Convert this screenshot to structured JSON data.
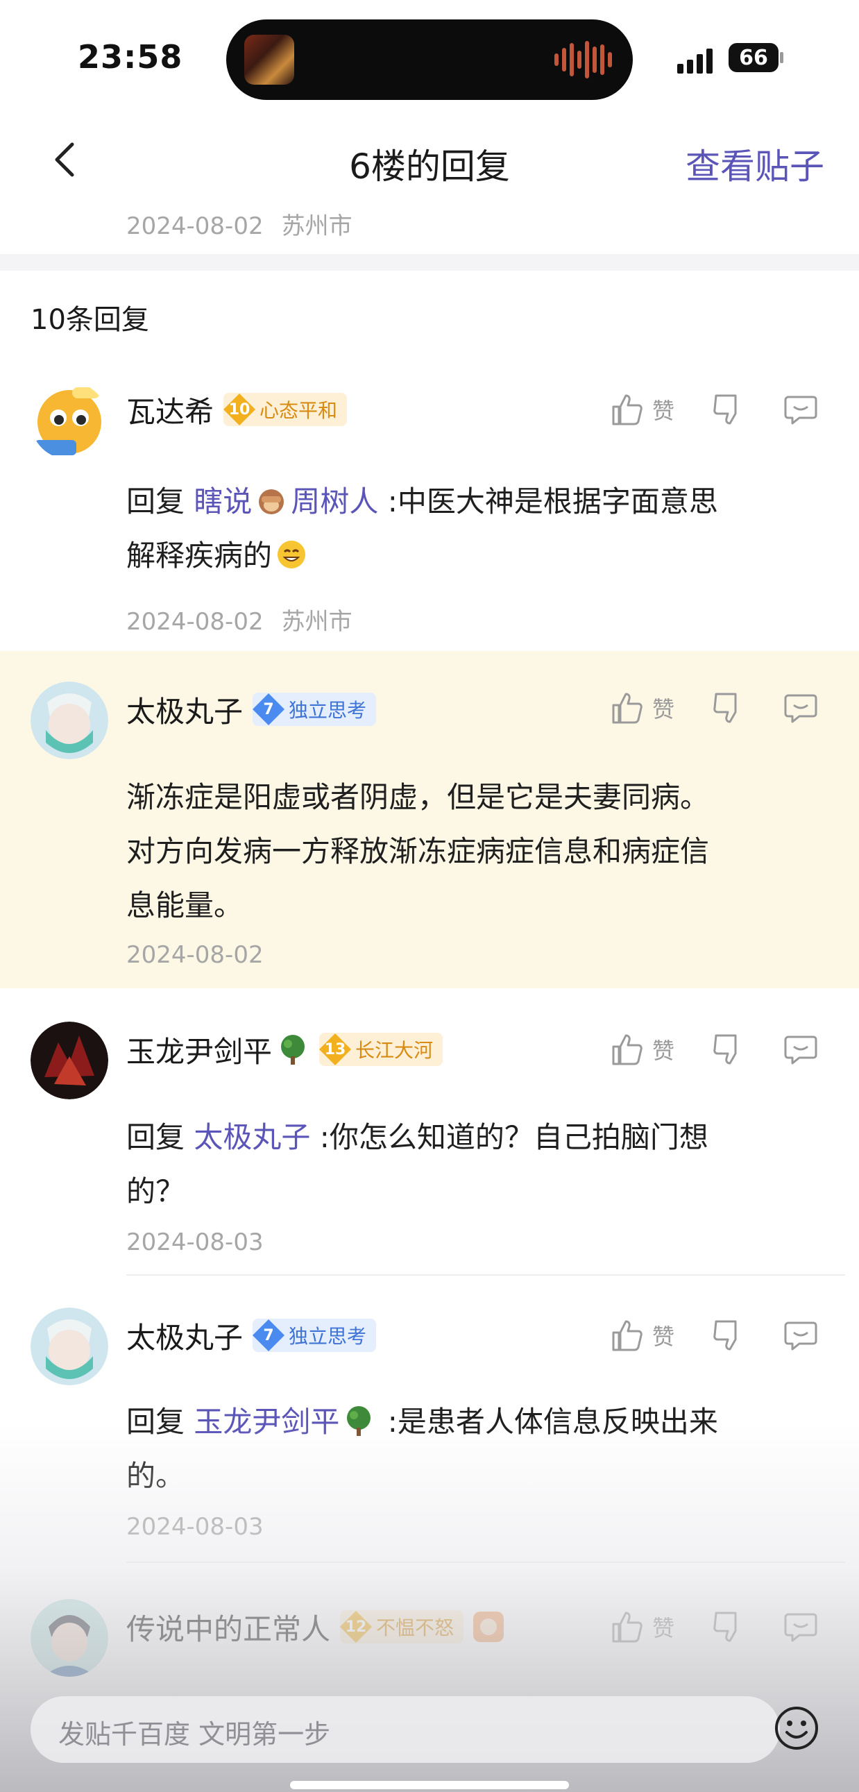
{
  "status_bar": {
    "time": "23:58",
    "battery": "66"
  },
  "nav": {
    "title": "6楼的回复",
    "view_post": "查看贴子"
  },
  "post_meta": {
    "date": "2024-08-02",
    "location": "苏州市"
  },
  "reply_count": "10条回复",
  "like_label": "赞",
  "replies": [
    {
      "name": "瓦达希",
      "badge_level": "10",
      "badge_text": "心态平和",
      "badge_color": "#f2b01e",
      "reply_prefix": "回复",
      "mentions": [
        "瞎说",
        "周树人"
      ],
      "text_before": ":中医大神是根据字面意思",
      "text_line2": "解释疾病的",
      "date": "2024-08-02",
      "location": "苏州市"
    },
    {
      "name": "太极丸子",
      "badge_level": "7",
      "badge_text": "独立思考",
      "badge_color": "#4b8bf0",
      "text_lines": [
        "渐冻症是阳虚或者阴虚，但是它是夫妻同病。",
        "对方向发病一方释放渐冻症病症信息和病症信",
        "息能量。"
      ],
      "date": "2024-08-02"
    },
    {
      "name": "玉龙尹剑平",
      "badge_level": "13",
      "badge_text": "长江大河",
      "badge_color": "#f2b01e",
      "reply_prefix": "回复",
      "mention": "太极丸子",
      "text_before": ":你怎么知道的？自己拍脑门想",
      "text_line2": "的？",
      "date": "2024-08-03"
    },
    {
      "name": "太极丸子",
      "badge_level": "7",
      "badge_text": "独立思考",
      "badge_color": "#4b8bf0",
      "reply_prefix": "回复",
      "mention": "玉龙尹剑平",
      "text_before": ":是患者人体信息反映出来",
      "text_line2": "的。",
      "date": "2024-08-03"
    },
    {
      "name": "传说中的正常人",
      "badge_level": "12",
      "badge_text": "不愠不怒",
      "badge_color": "#f2b01e"
    }
  ],
  "input": {
    "placeholder": "发贴千百度 文明第一步"
  },
  "icons": {
    "back": "chevron-left-icon",
    "like": "thumbs-up-icon",
    "dislike": "thumbs-down-icon",
    "comment": "comment-bubble-icon",
    "emoji": "smile-icon"
  }
}
